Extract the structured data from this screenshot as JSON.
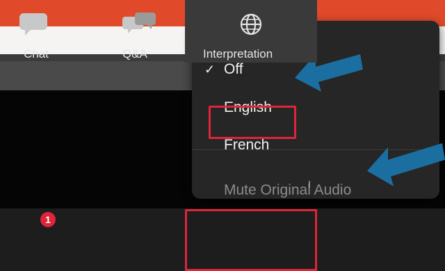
{
  "menu": {
    "items": [
      {
        "label": "Off",
        "checked": true
      },
      {
        "label": "English"
      },
      {
        "label": "French"
      }
    ],
    "check_glyph": "✓",
    "mute_label": "Mute Original Audio"
  },
  "toolbar": {
    "chat_label": "Chat",
    "chat_badge": "1",
    "qa_label": "Q&A",
    "interp_label": "Interpretation"
  },
  "colors": {
    "highlight_red": "#e0243a",
    "arrow_blue": "#1b6fa0",
    "top_bar_orange": "#e04a2a"
  }
}
